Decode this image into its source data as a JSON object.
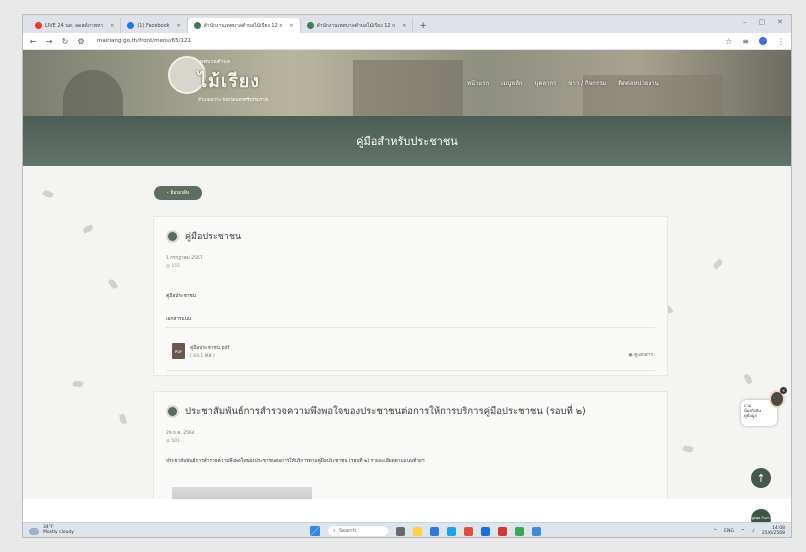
{
  "browser": {
    "tabs": [
      {
        "label": "LIVE 24 นส. ลดสด์ภาพหา",
        "favicon_color": "#e53935",
        "active": false
      },
      {
        "label": "(1) Facebook",
        "favicon_color": "#1877f2",
        "active": false
      },
      {
        "label": "สำนักงานเทศบาลตำบลไม้เรียง 12 ก",
        "favicon_color": "#3f7d58",
        "active": true
      },
      {
        "label": "สำนักงานเทศบาลตำบลไม้เรียง 12 ก",
        "favicon_color": "#3f7d58",
        "active": false
      }
    ],
    "new_tab": "+",
    "url": "mairiang.go.th/front/menu/65/121",
    "window_controls": [
      "–",
      "▢",
      "✕"
    ]
  },
  "site": {
    "logo_top": "เทศบาลตำบล",
    "logo_name": "ไม้เรียง",
    "logo_bottom": "อำเภอฉวาง จังหวัดนครศรีธรรมราช",
    "nav": [
      "หน้าแรก",
      "เมนูหลัก",
      "บุคลากร",
      "ข่าว / กิจกรรม",
      "ติดต่อหน่วยงาน"
    ],
    "page_title": "คู่มือสำหรับประชาชน",
    "back_label": "‹ ย้อนกลับ"
  },
  "cards": [
    {
      "title": "คู่มือประชาชน",
      "date": "1 กรกฎาคม 2567",
      "views": "◎ 155",
      "section_label": "คู่มือประชาชน",
      "attachments_label": "เอกสารแนบ",
      "file_type": "PDF",
      "file_name": "คู่มือประชาชน.pdf",
      "file_size": "( 43.1 MB )",
      "file_action": "◉ ดูเอกสาร"
    },
    {
      "title": "ประชาสัมพันธ์การสำรวจความพึงพอใจของประชาชนต่อการให้การบริการคู่มือประชาชน (รอบที่ ๒)",
      "date": "29 ธ.ค. 2564",
      "views": "◎ 501",
      "description": "ประชาสัมพันธ์การสำรวจความพึงพอใจของประชาชนต่อการให้บริการตามคู่มือประชาชน (รอบที่ ๒) รายละเอียดตามแนบท้ายฯ"
    }
  ],
  "widgets": {
    "assistant_text": [
      "ถาม",
      "น้องกังหัน",
      "ดูข้อมูล"
    ],
    "scroll_top": "↑",
    "chat_label": "พูดคุย\nกับเรา"
  },
  "taskbar": {
    "weather_temp": "34°F",
    "weather_desc": "Mostly cloudy",
    "search_placeholder": "Search",
    "tray_lang": "ENG",
    "time": "14:08",
    "date": "25/6/2568",
    "app_colors": [
      "#6a6a6a",
      "#ffd23f",
      "#2d7bd6",
      "#1aa3e8",
      "#e34c3c",
      "#1e6fd9",
      "#d03a2f",
      "#3aa757",
      "#3d8bd9"
    ]
  }
}
